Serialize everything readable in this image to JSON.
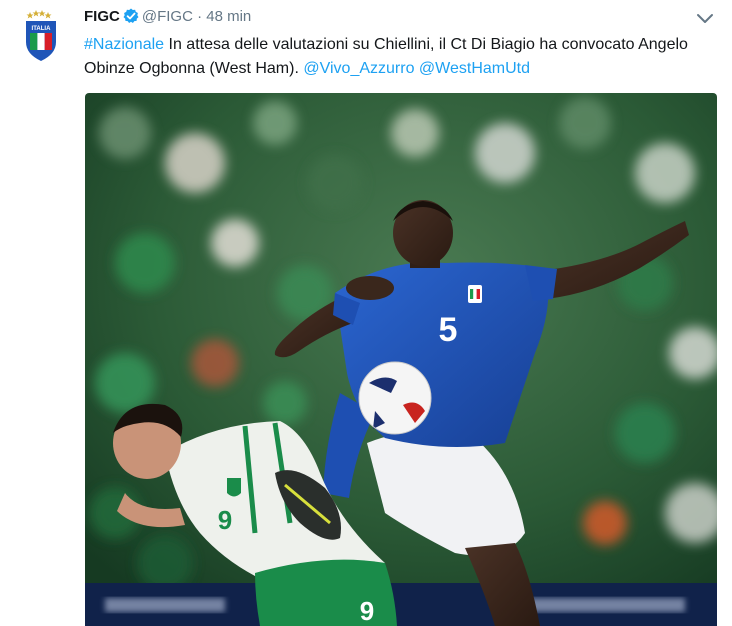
{
  "tweet": {
    "display_name": "FIGC",
    "handle": "@FIGC",
    "separator": " · ",
    "time": "48 min",
    "verified_icon": "verified-badge-icon",
    "menu_icon": "chevron-down-icon",
    "avatar_icon": "italia-crest-icon",
    "avatar_text": "ITALIA",
    "text": {
      "hashtag": "#Nazionale",
      "body": " In attesa delle valutazioni su Chiellini, il Ct Di Biagio ha convocato Angelo Obinze Ogbonna (West Ham). ",
      "mention_1": "@Vivo_Azzurro",
      "space": " ",
      "mention_2": "@WestHamUtd"
    },
    "media": {
      "player_front_number": "5",
      "player_back_number": "9",
      "player_back_shorts_number": "9"
    }
  },
  "colors": {
    "link": "#1da1f2",
    "verified": "#1da1f2",
    "meta_gray": "#657786",
    "italy_blue": "#1f55b8",
    "ireland_green": "#1a8c4a",
    "crowd_green": "#2e6b3c"
  }
}
